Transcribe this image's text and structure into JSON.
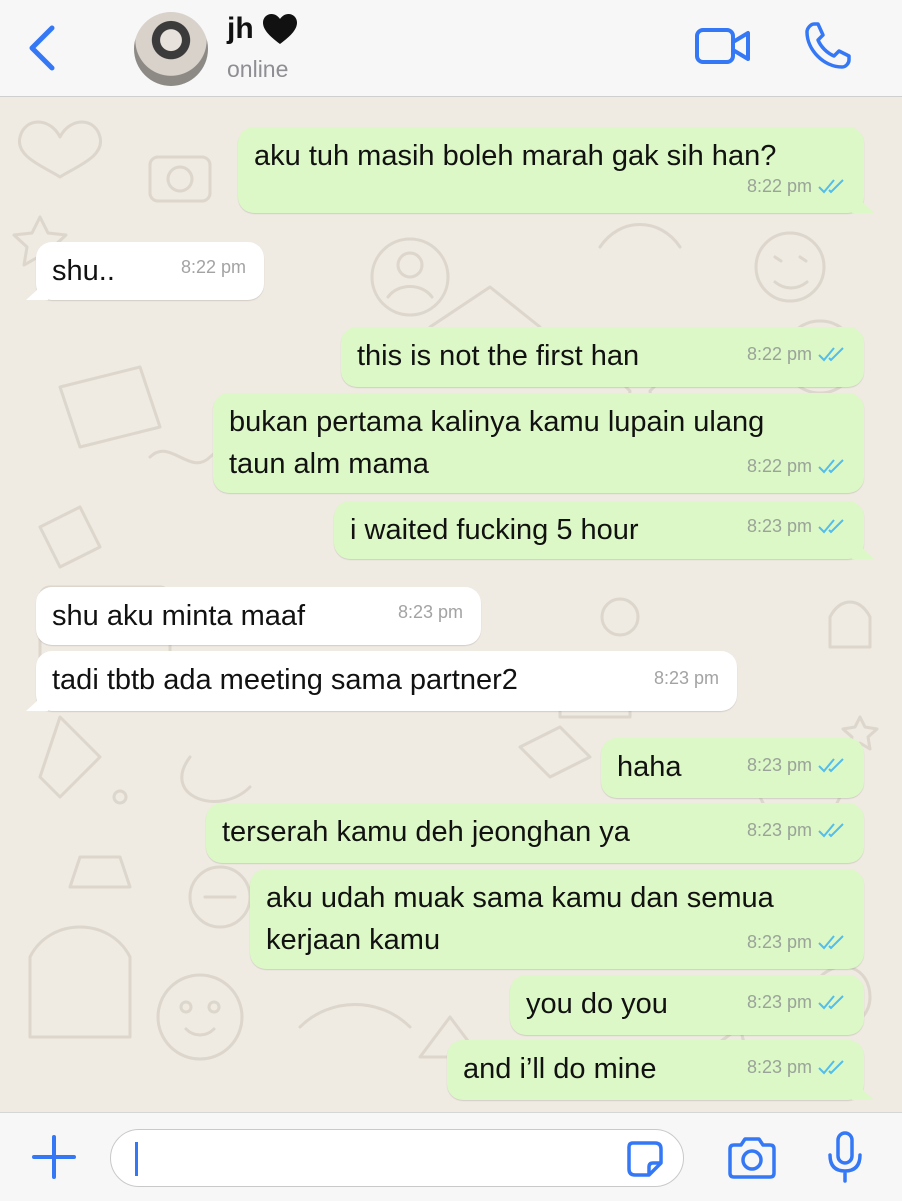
{
  "header": {
    "back_icon": "chevron-left-icon",
    "contact_name": "jh",
    "contact_emoji": "black-heart-icon",
    "status": "online",
    "video_icon": "video-call-icon",
    "phone_icon": "phone-call-icon"
  },
  "messages": [
    {
      "direction": "out",
      "text": "aku tuh masih boleh marah gak sih han?",
      "time": "8:22 pm",
      "read": true
    },
    {
      "direction": "in",
      "text": "shu..",
      "time": "8:22 pm"
    },
    {
      "direction": "out",
      "text": "this is not the first han",
      "time": "8:22 pm",
      "read": true
    },
    {
      "direction": "out",
      "text": "bukan pertama kalinya kamu lupain ulang\ntaun alm mama",
      "time": "8:22 pm",
      "read": true
    },
    {
      "direction": "out",
      "text": "i waited fucking 5 hour",
      "time": "8:23 pm",
      "read": true
    },
    {
      "direction": "in",
      "text": "shu aku minta maaf",
      "time": "8:23 pm"
    },
    {
      "direction": "in",
      "text": "tadi tbtb ada meeting sama partner2",
      "time": "8:23 pm"
    },
    {
      "direction": "out",
      "text": "haha",
      "time": "8:23 pm",
      "read": true
    },
    {
      "direction": "out",
      "text": "terserah kamu deh jeonghan ya",
      "time": "8:23 pm",
      "read": true
    },
    {
      "direction": "out",
      "text": "aku udah muak sama kamu dan semua\nkerjaan kamu",
      "time": "8:23 pm",
      "read": true
    },
    {
      "direction": "out",
      "text": "you do you",
      "time": "8:23 pm",
      "read": true
    },
    {
      "direction": "out",
      "text": "and i’ll do mine",
      "time": "8:23 pm",
      "read": true
    }
  ],
  "composer": {
    "input_value": "",
    "icons": [
      "plus-icon",
      "sticker-icon",
      "camera-icon",
      "microphone-icon"
    ]
  },
  "colors": {
    "accent": "#3478f6",
    "outgoing_bubble": "#dcf8c6",
    "incoming_bubble": "#ffffff",
    "chat_background": "#efeae2",
    "read_ticks": "#53bdeb"
  }
}
